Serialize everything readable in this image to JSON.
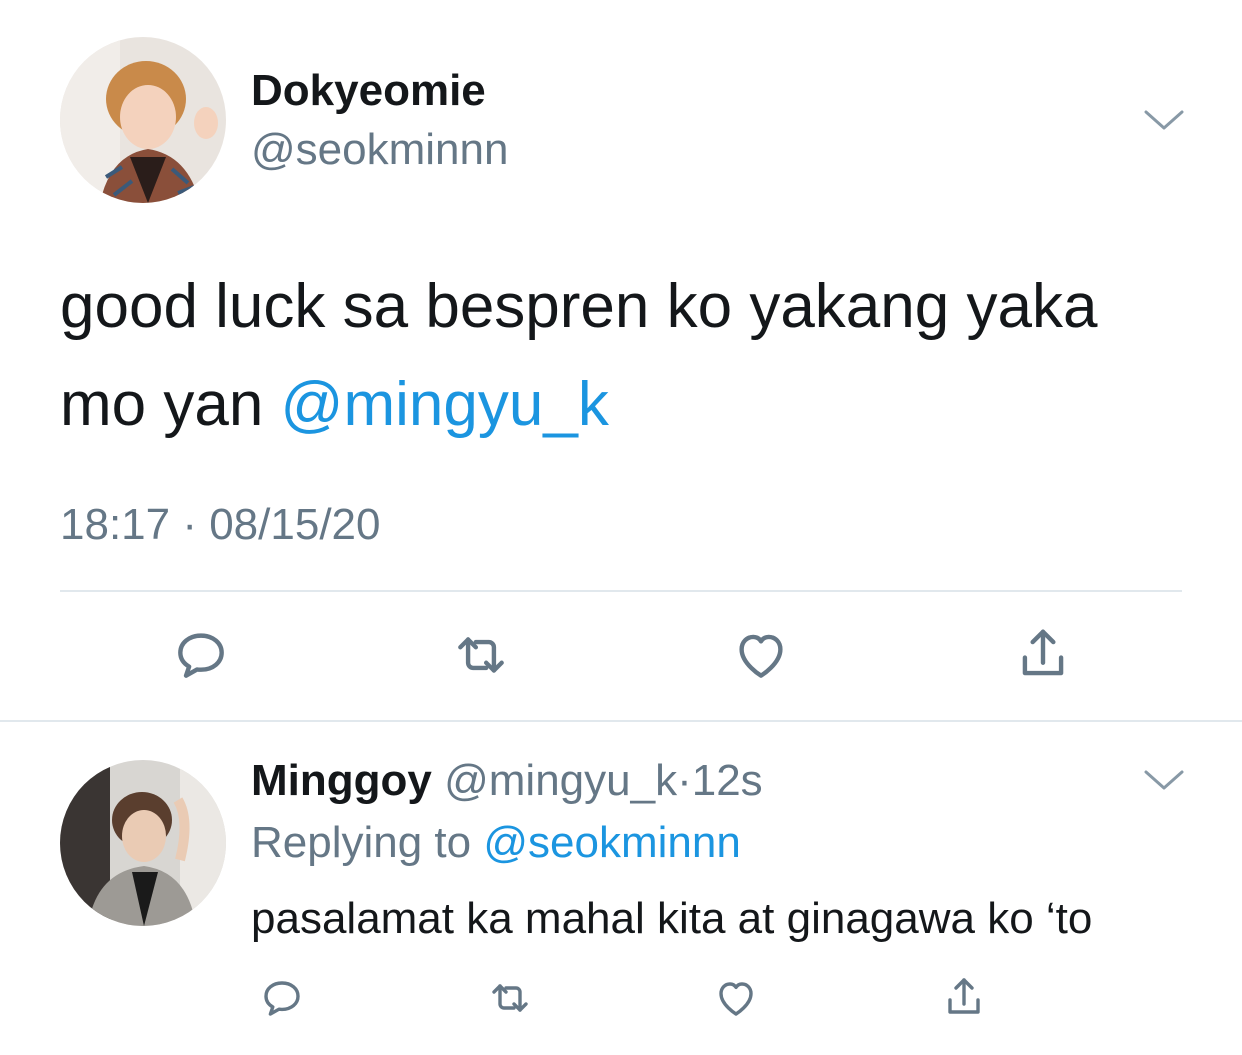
{
  "tweet": {
    "display_name": "Dokyeomie",
    "handle": "@seokminnn",
    "text_before_mention": "good luck sa bespren ko yakang yaka mo yan ",
    "mention": "@mingyu_k",
    "timestamp": "18:17 · 08/15/20",
    "avatar_icon": "user-photo-avatar"
  },
  "reply": {
    "display_name": "Minggoy",
    "handle": "@mingyu_k",
    "separator": "·",
    "age": "12s",
    "replying_prefix": "Replying to ",
    "replying_to": "@seokminnn",
    "text": "pasalamat ka mahal kita at ginagawa ko ‘to",
    "avatar_icon": "user-photo-avatar"
  },
  "actions": [
    "reply-icon",
    "retweet-icon",
    "like-icon",
    "share-icon"
  ],
  "colors": {
    "text": "#14171a",
    "secondary": "#657786",
    "link": "#1b95e0",
    "divider": "#e1e8ed"
  }
}
